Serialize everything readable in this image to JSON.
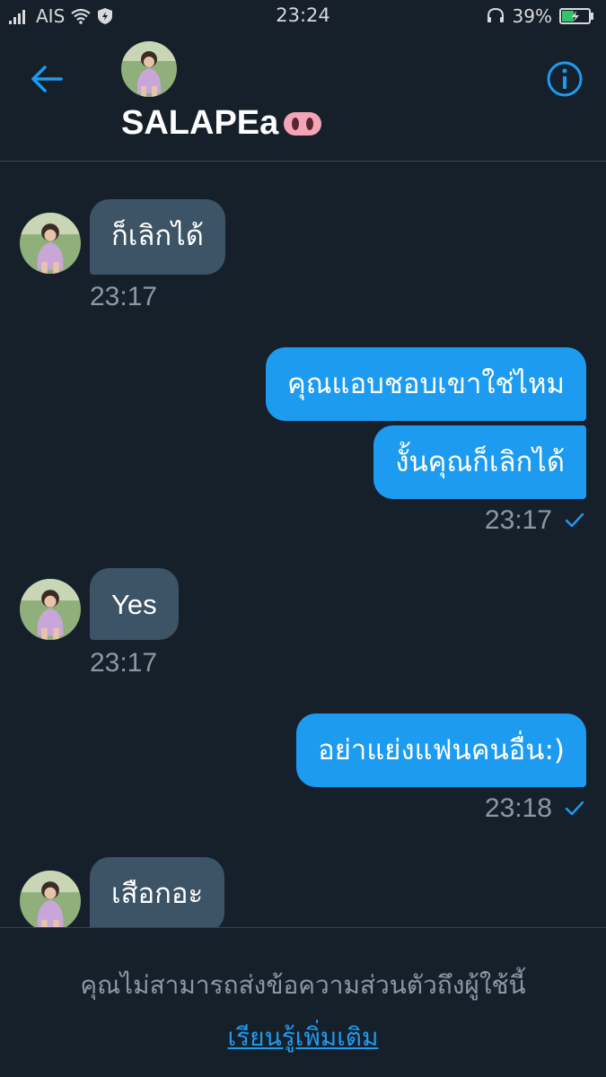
{
  "status_bar": {
    "carrier": "AIS",
    "time": "23:24",
    "battery": "39%"
  },
  "header": {
    "contact_name": "SALAPEa",
    "back_icon": "back-arrow-icon",
    "info_icon": "info-icon"
  },
  "messages": [
    {
      "direction": "in",
      "text": "ก็เลิกได้"
    },
    {
      "direction": "in",
      "time": "23:17"
    },
    {
      "direction": "out",
      "text": "คุณแอบชอบเขาใช่ไหม"
    },
    {
      "direction": "out",
      "text": "งั้นคุณก็เลิกได้"
    },
    {
      "direction": "out",
      "time": "23:17"
    },
    {
      "direction": "in",
      "text": "Yes"
    },
    {
      "direction": "in",
      "time": "23:17"
    },
    {
      "direction": "out",
      "text": "อย่าแย่งแฟนคนอื่น:)"
    },
    {
      "direction": "out",
      "time": "23:18"
    },
    {
      "direction": "in",
      "text": "เสือกอะ"
    }
  ],
  "footer": {
    "notice": "คุณไม่สามารถส่งข้อความส่วนตัวถึงผู้ใช้นี้",
    "learn_more": "เรียนรู้เพิ่มเติม"
  },
  "colors": {
    "background": "#15202b",
    "incoming_bubble": "#3d5466",
    "outgoing_bubble": "#1d9bf0",
    "accent": "#1d9bf0",
    "muted_text": "#8b98a5"
  }
}
